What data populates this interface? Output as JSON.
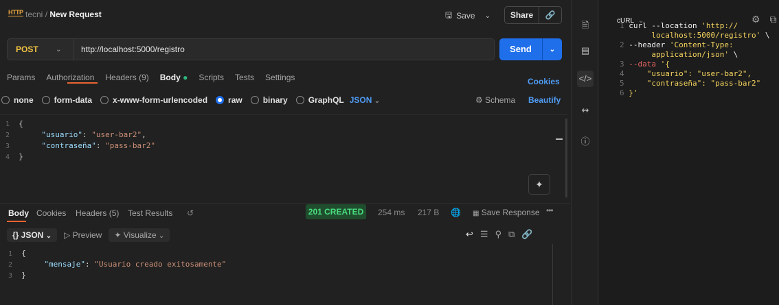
{
  "header": {
    "app_icon": "http-icon",
    "app_icon_text": "HTTP",
    "workspace": "tecni",
    "separator": "/",
    "request_name": "New Request",
    "save_label": "Save",
    "share_label": "Share"
  },
  "request": {
    "method": "POST",
    "url": "http://localhost:5000/registro",
    "send_label": "Send"
  },
  "tabs": [
    {
      "label": "Params"
    },
    {
      "label": "Authorization"
    },
    {
      "label": "Headers (9)"
    },
    {
      "label": "Body",
      "active": true,
      "dot": "●"
    },
    {
      "label": "Scripts"
    },
    {
      "label": "Tests"
    },
    {
      "label": "Settings"
    }
  ],
  "cookies_label": "Cookies",
  "body_modes": [
    {
      "label": "none"
    },
    {
      "label": "form-data"
    },
    {
      "label": "x-www-form-urlencoded"
    },
    {
      "label": "raw",
      "selected": true
    },
    {
      "label": "binary"
    },
    {
      "label": "GraphQL"
    }
  ],
  "body_format": "JSON",
  "schema_label": "Schema",
  "beautify_label": "Beautify",
  "request_body": [
    {
      "n": "1",
      "text": "{"
    },
    {
      "n": "2",
      "key": "\"usuario\"",
      "sep": ": ",
      "val": "\"user-bar2\"",
      "tail": ","
    },
    {
      "n": "3",
      "key": "\"contraseña\"",
      "sep": ": ",
      "val": "\"pass-bar2\"",
      "tail": ""
    },
    {
      "n": "4",
      "text": "}"
    }
  ],
  "response": {
    "tabs": [
      {
        "label": "Body",
        "active": true
      },
      {
        "label": "Cookies"
      },
      {
        "label": "Headers (5)"
      },
      {
        "label": "Test Results"
      }
    ],
    "status": "201 CREATED",
    "time": "254 ms",
    "size": "217 B",
    "save_response_label": "Save Response",
    "format_label": "{} JSON",
    "preview_label": "Preview",
    "visualize_label": "Visualize",
    "body": [
      {
        "n": "1",
        "text": "{"
      },
      {
        "n": "2",
        "key": "\"mensaje\"",
        "sep": ": ",
        "val": "\"Usuario creado exitosamente\""
      },
      {
        "n": "3",
        "text": "}"
      }
    ]
  },
  "snippet": {
    "language": "cURL",
    "lines": [
      {
        "n": "1",
        "parts": [
          {
            "t": "curl --location ",
            "c": "fl"
          },
          {
            "t": "'http://",
            "c": "s"
          }
        ]
      },
      {
        "n": "",
        "parts": [
          {
            "t": "     localhost:5000/registro'",
            "c": "s"
          },
          {
            "t": " \\",
            "c": "fl"
          }
        ]
      },
      {
        "n": "2",
        "parts": [
          {
            "t": "--header ",
            "c": "fl"
          },
          {
            "t": "'Content-Type:",
            "c": "s"
          }
        ]
      },
      {
        "n": "",
        "parts": [
          {
            "t": "     application/json'",
            "c": "s"
          },
          {
            "t": " \\",
            "c": "fl"
          }
        ]
      },
      {
        "n": "3",
        "parts": [
          {
            "t": "--data ",
            "c": "dk"
          },
          {
            "t": "'{",
            "c": "s"
          }
        ]
      },
      {
        "n": "4",
        "parts": [
          {
            "t": "    \"usuario\": \"user-bar2\",",
            "c": "s"
          }
        ]
      },
      {
        "n": "5",
        "parts": [
          {
            "t": "    \"contraseña\": \"pass-bar2\"",
            "c": "s"
          }
        ]
      },
      {
        "n": "6",
        "parts": [
          {
            "t": "}'",
            "c": "s"
          }
        ]
      }
    ]
  },
  "colors": {
    "accent": "#1f6feb",
    "method": "#f4c542",
    "status_bg": "#1f4d2d",
    "status_fg": "#4ade80",
    "tab_underline": "#e86430"
  }
}
